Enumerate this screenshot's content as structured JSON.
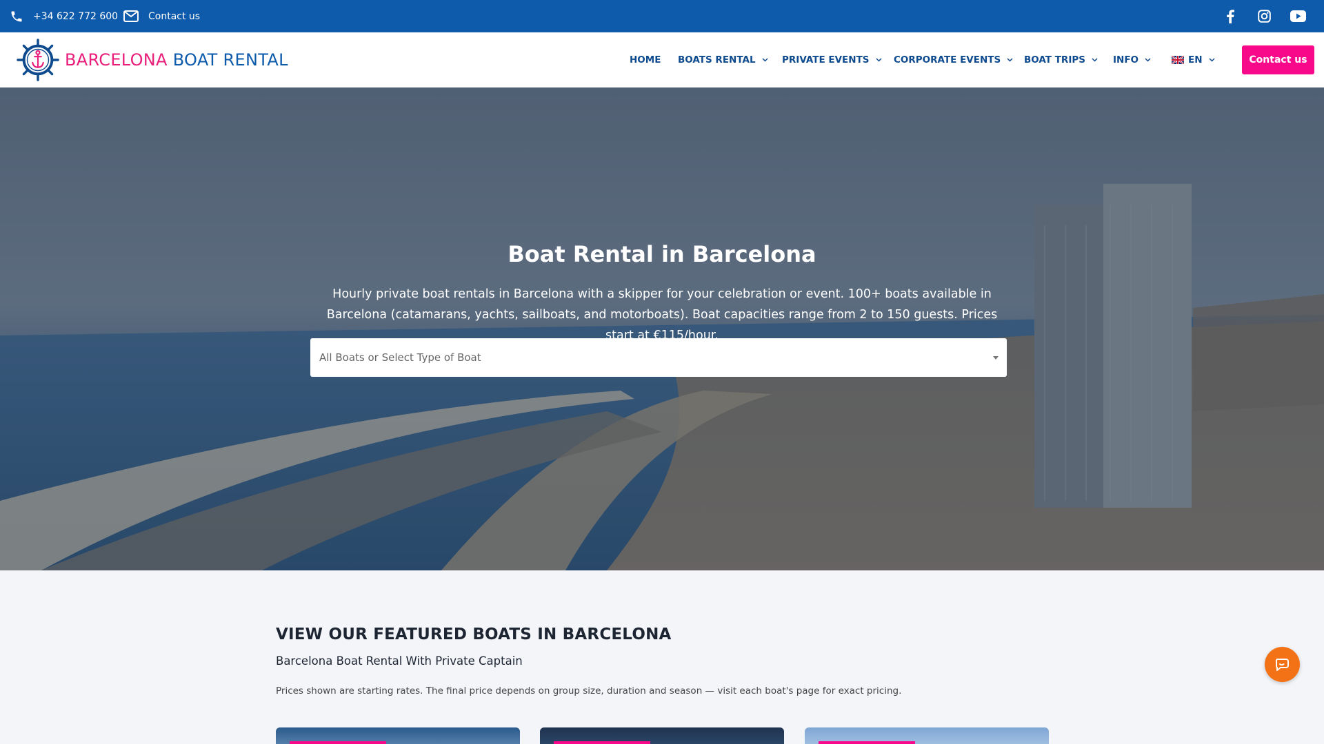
{
  "topbar": {
    "phone": "+34 622 772 600",
    "contact_label": "Contact us",
    "social": [
      "facebook-icon",
      "instagram-icon",
      "youtube-icon"
    ]
  },
  "header": {
    "logo_part1": "BARCELONA",
    "logo_part2": "BOAT RENTAL",
    "nav": {
      "home": "HOME",
      "boats": "BOATS RENTAL",
      "private": "PRIVATE EVENTS",
      "corporate": "CORPORATE EVENTS",
      "trips": "BOAT TRIPS",
      "info": "INFO",
      "lang": "EN"
    },
    "cta": "Contact us"
  },
  "hero": {
    "title": "Boat Rental in Barcelona",
    "text": "Hourly private boat rentals in Barcelona with a skipper for your celebration or event. 100+ boats available in Barcelona (catamarans, yachts, sailboats, and motorboats). Boat capacities range from 2 to 150 guests. Prices start at €115/hour.",
    "select_placeholder": "All Boats or Select Type of Boat"
  },
  "featured": {
    "title": "VIEW OUR FEATURED BOATS IN BARCELONA",
    "subtitle": "Barcelona Boat Rental With Private Captain",
    "note": "Prices shown are starting rates. The final price depends on group size, duration and season — visit each boat's page for exact pricing."
  },
  "colors": {
    "topbar": "#0e5aab",
    "accent_pink": "#f7098a",
    "nav_text": "#0e4a8e",
    "chat": "#f47216"
  }
}
